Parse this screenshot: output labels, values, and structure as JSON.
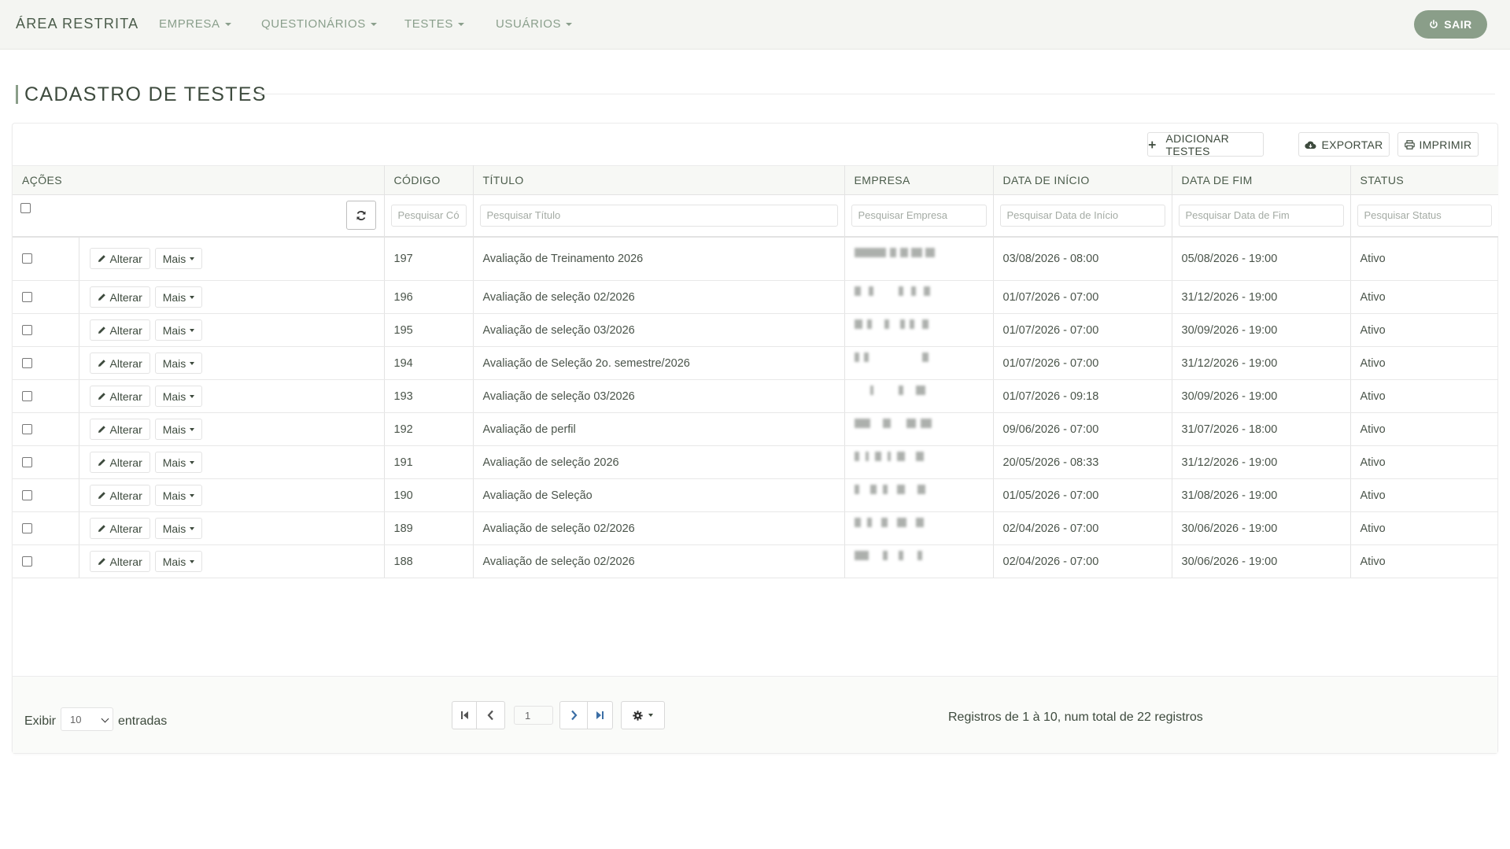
{
  "navbar": {
    "brand": "ÁREA RESTRITA",
    "menu": [
      "EMPRESA",
      "QUESTIONÁRIOS",
      "TESTES",
      "USUÁRIOS"
    ],
    "logout_label": "SAIR",
    "logout_icon": "power-icon"
  },
  "page": {
    "title": "CADASTRO DE TESTES"
  },
  "toolbar": {
    "add_label": "ADICIONAR TESTES",
    "export_label": "EXPORTAR",
    "print_label": "IMPRIMIR"
  },
  "table": {
    "columns": [
      "AÇÕES",
      "CÓDIGO",
      "TÍTULO",
      "EMPRESA",
      "DATA DE INÍCIO",
      "DATA DE FIM",
      "STATUS"
    ],
    "filters": {
      "codigo": "Pesquisar Código",
      "titulo": "Pesquisar Título",
      "empresa": "Pesquisar Empresa",
      "inicio": "Pesquisar Data de Início",
      "fim": "Pesquisar Data de Fim",
      "status": "Pesquisar Status"
    },
    "row_actions": {
      "edit": "Alterar",
      "more": "Mais"
    },
    "rows": [
      {
        "codigo": "197",
        "titulo": "Avaliação de Treinamento 2026",
        "empresa": "",
        "inicio": "03/08/2026 - 08:00",
        "fim": "05/08/2026 - 19:00",
        "status": "Ativo"
      },
      {
        "codigo": "196",
        "titulo": "Avaliação de seleção 02/2026",
        "empresa": "",
        "inicio": "01/07/2026 - 07:00",
        "fim": "31/12/2026 - 19:00",
        "status": "Ativo"
      },
      {
        "codigo": "195",
        "titulo": "Avaliação de seleção 03/2026",
        "empresa": "",
        "inicio": "01/07/2026 - 07:00",
        "fim": "30/09/2026 - 19:00",
        "status": "Ativo"
      },
      {
        "codigo": "194",
        "titulo": "Avaliação de Seleção 2o. semestre/2026",
        "empresa": "",
        "inicio": "01/07/2026 - 07:00",
        "fim": "31/12/2026 - 19:00",
        "status": "Ativo"
      },
      {
        "codigo": "193",
        "titulo": "Avaliação de seleção 03/2026",
        "empresa": "",
        "inicio": "01/07/2026 - 09:18",
        "fim": "30/09/2026 - 19:00",
        "status": "Ativo"
      },
      {
        "codigo": "192",
        "titulo": "Avaliação de perfil",
        "empresa": "",
        "inicio": "09/06/2026 - 07:00",
        "fim": "31/07/2026 - 18:00",
        "status": "Ativo"
      },
      {
        "codigo": "191",
        "titulo": "Avaliação de seleção 2026",
        "empresa": "",
        "inicio": "20/05/2026 - 08:33",
        "fim": "31/12/2026 - 19:00",
        "status": "Ativo"
      },
      {
        "codigo": "190",
        "titulo": "Avaliação de Seleção",
        "empresa": "",
        "inicio": "01/05/2026 - 07:00",
        "fim": "31/08/2026 - 19:00",
        "status": "Ativo"
      },
      {
        "codigo": "189",
        "titulo": "Avaliação de seleção 02/2026",
        "empresa": "",
        "inicio": "02/04/2026 - 07:00",
        "fim": "30/06/2026 - 19:00",
        "status": "Ativo"
      },
      {
        "codigo": "188",
        "titulo": "Avaliação de seleção 02/2026",
        "empresa": "",
        "inicio": "02/04/2026 - 07:00",
        "fim": "30/06/2026 - 19:00",
        "status": "Ativo"
      }
    ]
  },
  "footer": {
    "show_label": "Exibir",
    "page_size": "10",
    "entries_label": "entradas",
    "current_page": "1",
    "records_text": "Registros de 1 à 10, num total de 22 registros"
  },
  "colors": {
    "accent": "#8a9e89",
    "nav_text": "#8a9f8c",
    "heading": "#3e4b3e"
  }
}
